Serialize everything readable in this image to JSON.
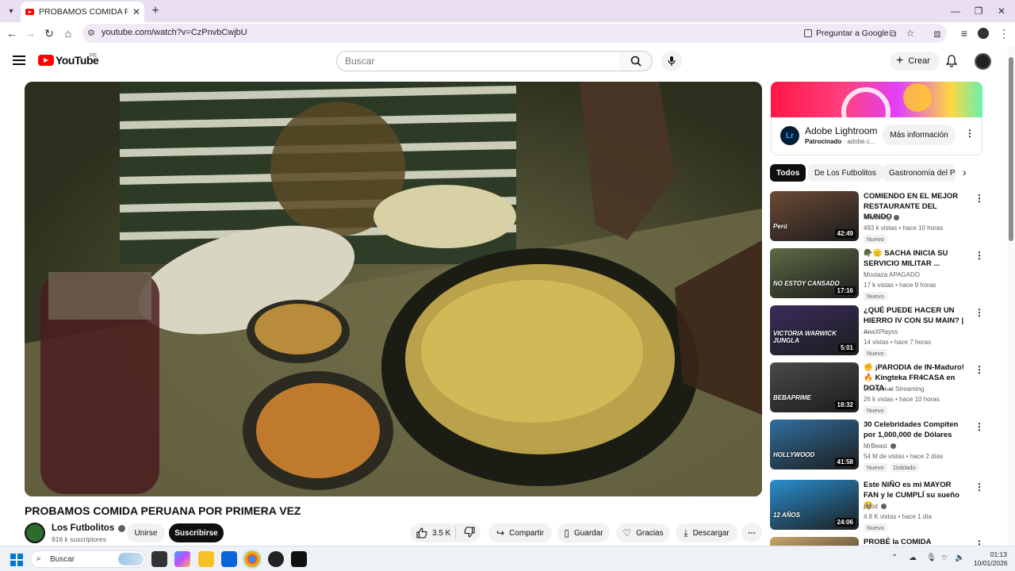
{
  "browser": {
    "tab_title": "PROBAMOS COMIDA PERUANA POR PRIMERA VEZ",
    "url": "youtube.com/watch?v=CzPnvbCwjbU",
    "ask_google": "Preguntar a Google"
  },
  "header": {
    "logo_text": "YouTube",
    "country": "PE",
    "search_placeholder": "Buscar",
    "create_label": "Crear"
  },
  "video": {
    "title": "PROBAMOS COMIDA PERUANA POR PRIMERA VEZ",
    "channel": "Los Futbolitos",
    "subscribers": "916 k suscriptores",
    "join_label": "Unirse",
    "subscribe_label": "Suscribirse",
    "likes": "3.5 K",
    "share_label": "Compartir",
    "save_label": "Guardar",
    "thanks_label": "Gracias",
    "download_label": "Descargar"
  },
  "ad": {
    "logo": "Lr",
    "title": "Adobe Lightroom",
    "sponsored": "Patrocinado",
    "domain": "adobe.c...",
    "cta": "Más información"
  },
  "chips": [
    "Todos",
    "De Los Futbolitos",
    "Gastronomía del Pe"
  ],
  "recommendations": [
    {
      "title": "COMIENDO EN EL MEJOR RESTAURANTE DEL MUNDO",
      "channel": "TheGrefg",
      "verified": true,
      "stats": "493 k vistas • hace 10 horas",
      "badges": [
        "Nuevo"
      ],
      "duration": "42:49",
      "thumb_overlay": "Perú",
      "thumb_color": "#6b4a35"
    },
    {
      "title": "🪖🫡 SACHA INICIA SU SERVICIO MILITAR ...",
      "channel": "Mostaza APAGADO",
      "verified": false,
      "stats": "17 k vistas • hace 9 horas",
      "badges": [
        "Nuevo"
      ],
      "duration": "17:16",
      "thumb_overlay": "NO ESTOY CANSADO",
      "thumb_color": "#5d6b45"
    },
    {
      "title": "¿QUÉ PUEDE HACER UN HIERRO IV CON SU MAIN? | ...",
      "channel": "AnaXPlayss",
      "verified": false,
      "stats": "14 vistas • hace 7 horas",
      "badges": [
        "Nuevo"
      ],
      "duration": "5:01",
      "thumb_overlay": "VICTORIA WARWICK JUNGLA",
      "thumb_color": "#3a2d5c"
    },
    {
      "title": "✊ ¡PARODIA de IN-Maduro! 🔥 Kingteka FR4CASA en DOTA ...",
      "channel": "Vivo por el Streaming",
      "verified": false,
      "stats": "26 k vistas • hace 10 horas",
      "badges": [
        "Nuevo"
      ],
      "duration": "18:32",
      "thumb_overlay": "BEBAPRIME",
      "thumb_color": "#4a4a4a"
    },
    {
      "title": "30 Celebridades Compiten por 1,000,000 de Dólares",
      "channel": "MrBeast",
      "verified": true,
      "stats": "54 M de vistas • hace 2 días",
      "badges": [
        "Nuevo",
        "Doblado"
      ],
      "duration": "41:58",
      "thumb_overlay": "HOLLYWOOD",
      "thumb_color": "#2f6f9f"
    },
    {
      "title": "Este NIÑO es mi MAYOR FAN y le CUMPLÍ su sueño 🥹",
      "channel": "pgod",
      "verified": true,
      "stats": "4.8 K vistas • hace 1 día",
      "badges": [
        "Nuevo"
      ],
      "duration": "24:06",
      "thumb_overlay": "12 AÑOS",
      "thumb_color": "#2a8fd0"
    },
    {
      "title": "PROBÉ la COMIDA PERUANA",
      "channel": "",
      "verified": false,
      "stats": "",
      "badges": [],
      "duration": "",
      "thumb_overlay": "",
      "thumb_color": "#c9a56a"
    }
  ],
  "taskbar": {
    "search_label": "Buscar",
    "time": "01:13",
    "date": "10/01/2026"
  }
}
